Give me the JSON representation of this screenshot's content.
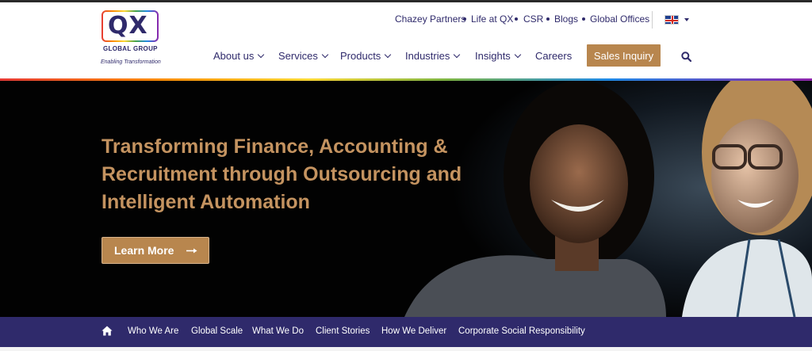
{
  "logo": {
    "mark": "QX",
    "group": "GLOBAL GROUP",
    "tagline": "Enabling Transformation"
  },
  "top_links": [
    "Chazey Partners",
    "Life at QX",
    "CSR",
    "Blogs",
    "Global Offices"
  ],
  "language": {
    "flag_icon": "uk-flag-icon"
  },
  "nav": {
    "items": [
      {
        "label": "About us",
        "has_dropdown": true
      },
      {
        "label": "Services",
        "has_dropdown": true
      },
      {
        "label": "Products",
        "has_dropdown": true
      },
      {
        "label": "Industries",
        "has_dropdown": true
      },
      {
        "label": "Insights",
        "has_dropdown": true
      },
      {
        "label": "Careers",
        "has_dropdown": false
      }
    ],
    "cta": "Sales Inquiry",
    "search_icon": "search-icon"
  },
  "hero": {
    "title": "Transforming Finance, Accounting & Recruitment through Outsourcing and Intelligent Automation",
    "button": "Learn More"
  },
  "subnav": {
    "home_icon": "home-icon",
    "items": [
      "Who We Are",
      "Global Scale",
      "What We Do",
      "Client Stories",
      "How We Deliver",
      "Corporate Social Responsibility"
    ]
  },
  "colors": {
    "brand_navy": "#2f2a6b",
    "accent_gold": "#b8864e",
    "hero_title": "#c49360",
    "hero_bg": "#020202"
  }
}
